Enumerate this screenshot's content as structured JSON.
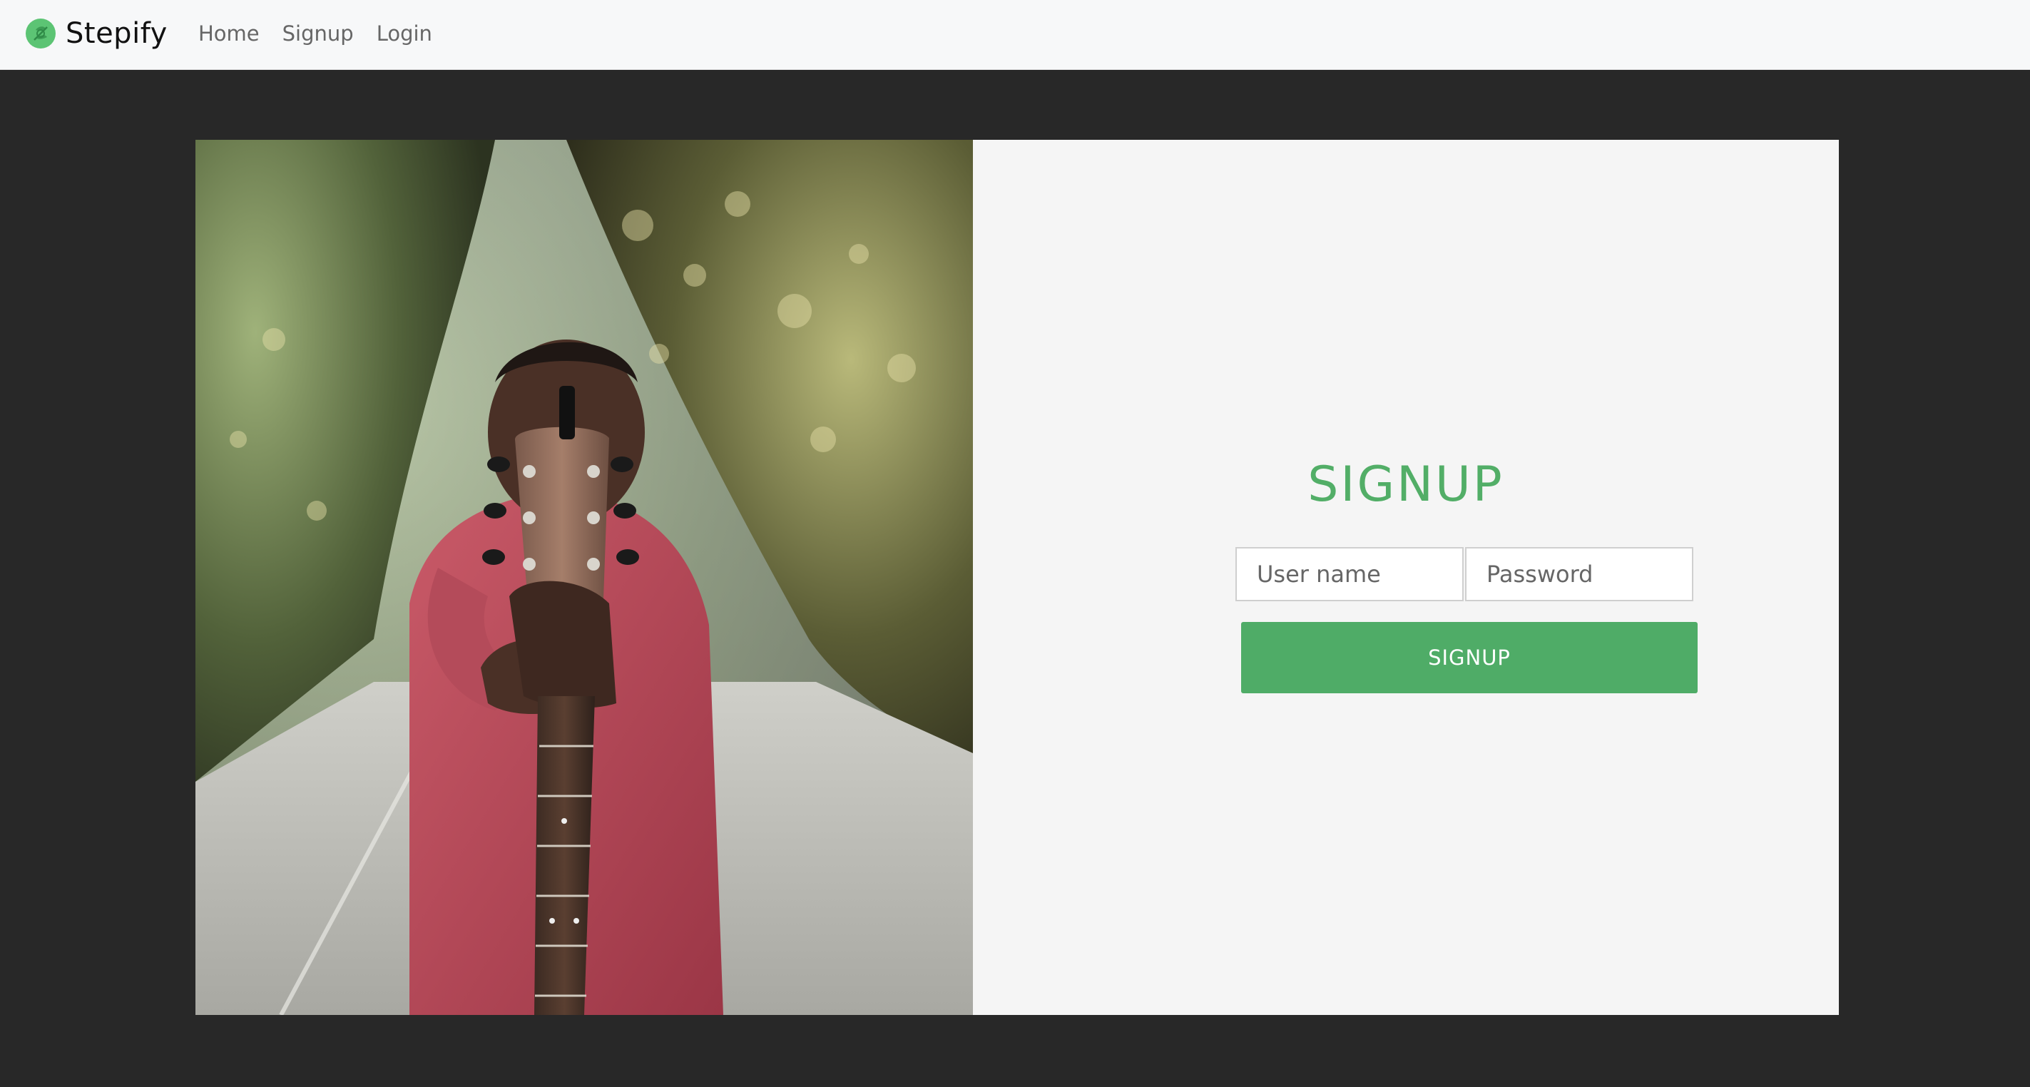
{
  "navbar": {
    "brand": "Stepify",
    "logo_icon": "leaf-logo-icon",
    "links": [
      {
        "label": "Home"
      },
      {
        "label": "Signup"
      },
      {
        "label": "Login"
      }
    ]
  },
  "hero_image": {
    "description_icon": "person-holding-guitar-photo"
  },
  "form": {
    "title": "SIGNUP",
    "username_placeholder": "User name",
    "password_placeholder": "Password",
    "submit_label": "SIGNUP"
  },
  "colors": {
    "accent": "#52ae67",
    "button": "#4fac67",
    "page_background": "#282828",
    "navbar_background": "#f7f8f9",
    "form_background": "#f5f5f5"
  }
}
